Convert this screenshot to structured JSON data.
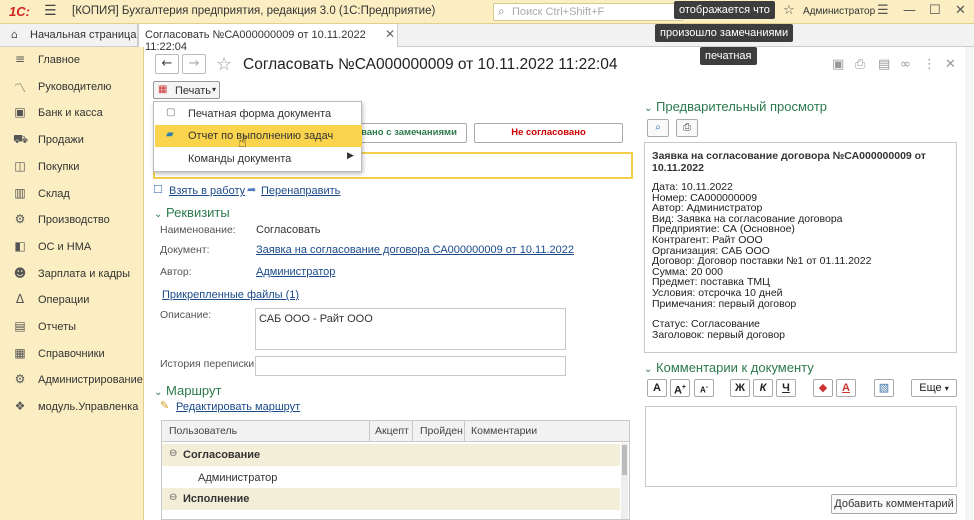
{
  "titlebar": {
    "logo": "1С:",
    "title": "[КОПИЯ] Бухгалтерия предприятия, редакция 3.0  (1С:Предприятие)",
    "search_placeholder": "Поиск Ctrl+Shift+F",
    "user": "Администратор"
  },
  "tabs": {
    "home": "Начальная страница",
    "doc": "Согласовать №СА000000009 от 10.11.2022 11:22:04"
  },
  "sidebar": {
    "items": [
      {
        "label": "Главное",
        "icon": "menu-icon"
      },
      {
        "label": "Руководителю",
        "icon": "chart-line-icon"
      },
      {
        "label": "Банк и касса",
        "icon": "bank-icon"
      },
      {
        "label": "Продажи",
        "icon": "cart-icon"
      },
      {
        "label": "Покупки",
        "icon": "basket-icon"
      },
      {
        "label": "Склад",
        "icon": "warehouse-icon"
      },
      {
        "label": "Производство",
        "icon": "factory-icon"
      },
      {
        "label": "ОС и НМА",
        "icon": "assets-icon"
      },
      {
        "label": "Зарплата и кадры",
        "icon": "person-icon"
      },
      {
        "label": "Операции",
        "icon": "operations-icon"
      },
      {
        "label": "Отчеты",
        "icon": "report-icon"
      },
      {
        "label": "Справочники",
        "icon": "book-icon"
      },
      {
        "label": "Администрирование",
        "icon": "gear-icon"
      },
      {
        "label": "модуль.Управленка",
        "icon": "module-icon"
      }
    ]
  },
  "document": {
    "title": "Согласовать №СА000000009 от 10.11.2022 11:22:04",
    "print_label": "Печать",
    "menu": [
      "Печатная форма документа",
      "Отчет по выполнению задач",
      "Команды документа"
    ],
    "btn_remarks": "вано с замечаниями",
    "btn_rejected": "Не согласовано",
    "take_to_work": "Взять в работу",
    "redirect": "Перенаправить",
    "section_requisites": "Реквизиты",
    "name_label": "Наименование:",
    "name_value": "Согласовать",
    "doc_label": "Документ:",
    "doc_value": "Заявка на согласование договора СА000000009 от 10.11.2022",
    "author_label": "Автор:",
    "author_value": "Администратор",
    "attached_files": "Прикрепленные файлы (1)",
    "desc_label": "Описание:",
    "desc_value": "САБ ООО - Райт ООО",
    "history_label": "История переписки:",
    "section_route": "Маршрут",
    "edit_route": "Редактировать маршрут"
  },
  "route_table": {
    "headers": [
      "Пользователь",
      "Акцепт",
      "Пройден",
      "Комментарии"
    ],
    "rows": [
      {
        "label": "Согласование",
        "group": true
      },
      {
        "label": "Администратор",
        "group": false
      },
      {
        "label": "Исполнение",
        "group": true
      }
    ]
  },
  "preview": {
    "header": "Предварительный просмотр",
    "title": "Заявка на согласование договора №СА000000009 от 10.11.2022",
    "lines": [
      "Дата: 10.11.2022",
      "Номер: СА000000009",
      "Автор: Администратор",
      "Вид: Заявка на согласование договора",
      "Предприятие: СА (Основное)",
      "Контрагент: Райт ООО",
      "Организация: САБ ООО",
      "Договор: Договор поставки №1 от 01.11.2022",
      "Сумма: 20 000",
      "Предмет: поставка ТМЦ",
      "Условия: отсрочка 10 дней",
      "Примечания: первый договор"
    ],
    "status": "Статус: Согласование",
    "subject": "Заголовок: первый договор"
  },
  "comments": {
    "header": "Комментарии к документу",
    "more_label": "Еще",
    "add_label": "Добавить комментарий"
  },
  "tooltips": {
    "t1": "отображается что",
    "t2": "произошло замечаниями",
    "t3": "печатная"
  },
  "colors": {
    "sidebar_bg": "#fbeec2",
    "selected_menu": "#fbd44d",
    "section_green": "#2c7a4d",
    "link_blue": "#1a4a8a",
    "reject_red": "#cc0000"
  }
}
